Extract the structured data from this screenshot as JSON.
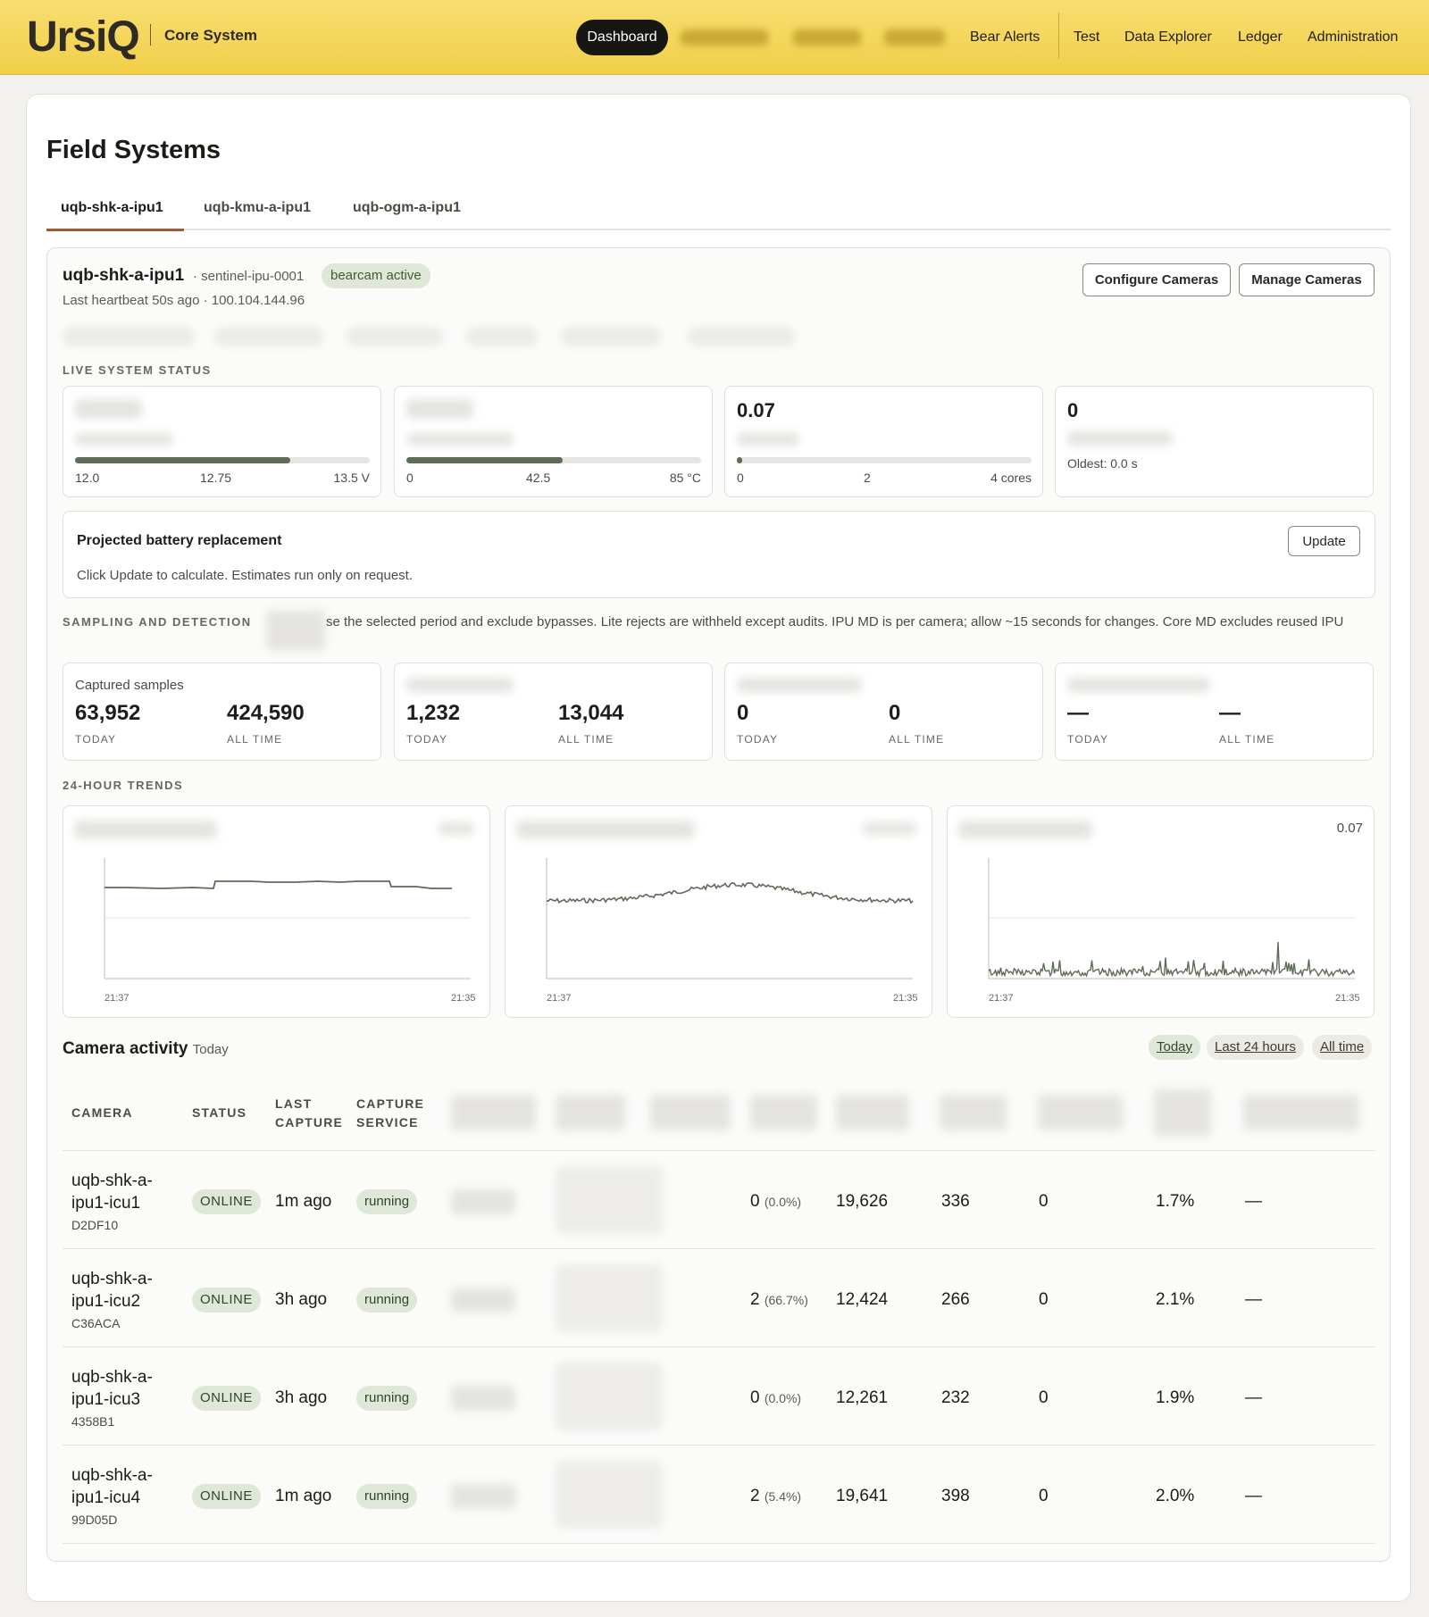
{
  "header": {
    "logo": "UrsiQ",
    "app_name": "Core System",
    "nav_active": "Dashboard",
    "nav_items": [
      "Bear Alerts",
      "Test",
      "Data Explorer",
      "Ledger",
      "Administration"
    ]
  },
  "page": {
    "title": "Field Systems",
    "tabs": [
      "uqb-shk-a-ipu1",
      "uqb-kmu-a-ipu1",
      "uqb-ogm-a-ipu1"
    ]
  },
  "system": {
    "name": "uqb-shk-a-ipu1",
    "meta": "· sentinel-ipu-0001",
    "badge": "bearcam active",
    "heartbeat": "Last heartbeat 50s ago · 100.104.144.96",
    "configure_label": "Configure Cameras",
    "manage_label": "Manage Cameras"
  },
  "live": {
    "label": "LIVE SYSTEM STATUS",
    "voltage": {
      "fill": 0.73,
      "scale": [
        "12.0",
        "12.75",
        "13.5 V"
      ]
    },
    "temperature": {
      "fill": 0.53,
      "scale": [
        "0",
        "42.5",
        "85 °C"
      ]
    },
    "load": {
      "value": "0.07",
      "fill": 0.018,
      "scale": [
        "0",
        "2",
        "4 cores"
      ]
    },
    "queue": {
      "value": "0",
      "oldest": "Oldest: 0.0 s"
    }
  },
  "battery": {
    "title": "Projected battery replacement",
    "desc": "Click Update to calculate. Estimates run only on request.",
    "update_label": "Update"
  },
  "sampling": {
    "label": "SAMPLING AND DETECTION",
    "note": "se the selected period and exclude bypasses. Lite rejects are withheld except audits. IPU MD is per camera; allow ~15 seconds for changes. Core MD excludes reused IPU",
    "cards": [
      {
        "label": "Captured samples",
        "today": "63,952",
        "all": "424,590"
      },
      {
        "label": "",
        "today": "1,232",
        "all": "13,044"
      },
      {
        "label": "",
        "today": "0",
        "all": "0"
      },
      {
        "label": "",
        "today": "—",
        "all": "—"
      }
    ],
    "today_cap": "TODAY",
    "all_cap": "ALL TIME"
  },
  "trends": {
    "label": "24-HOUR TRENDS",
    "start": "21:37",
    "end": "21:35",
    "load_value": "0.07"
  },
  "cameras": {
    "title": "Camera activity",
    "subtitle": "Today",
    "ranges": [
      "Today",
      "Last 24 hours",
      "All time"
    ],
    "headers": {
      "camera": "CAMERA",
      "status": "STATUS",
      "last_capture": [
        "LAST",
        "CAPTURE"
      ],
      "capture_service": [
        "CAPTURE",
        "SERVICE"
      ]
    },
    "rows": [
      {
        "name1": "uqb-shk-a-",
        "name2": "ipu1-icu1",
        "id": "D2DF10",
        "status": "ONLINE",
        "last": "1m ago",
        "service": "running",
        "a": "0",
        "a_pct": "(0.0%)",
        "b": "19,626",
        "c": "336",
        "d": "0",
        "e": "1.7%",
        "f": "—"
      },
      {
        "name1": "uqb-shk-a-",
        "name2": "ipu1-icu2",
        "id": "C36ACA",
        "status": "ONLINE",
        "last": "3h ago",
        "service": "running",
        "a": "2",
        "a_pct": "(66.7%)",
        "b": "12,424",
        "c": "266",
        "d": "0",
        "e": "2.1%",
        "f": "—"
      },
      {
        "name1": "uqb-shk-a-",
        "name2": "ipu1-icu3",
        "id": "4358B1",
        "status": "ONLINE",
        "last": "3h ago",
        "service": "running",
        "a": "0",
        "a_pct": "(0.0%)",
        "b": "12,261",
        "c": "232",
        "d": "0",
        "e": "1.9%",
        "f": "—"
      },
      {
        "name1": "uqb-shk-a-",
        "name2": "ipu1-icu4",
        "id": "99D05D",
        "status": "ONLINE",
        "last": "1m ago",
        "service": "running",
        "a": "2",
        "a_pct": "(5.4%)",
        "b": "19,641",
        "c": "398",
        "d": "0",
        "e": "2.0%",
        "f": "—"
      }
    ]
  },
  "colors": {
    "accent": "#f1cf48",
    "line": "#5e6b58",
    "tab_underline": "#9a5b3a",
    "badge_bg": "#dfe8d8"
  }
}
